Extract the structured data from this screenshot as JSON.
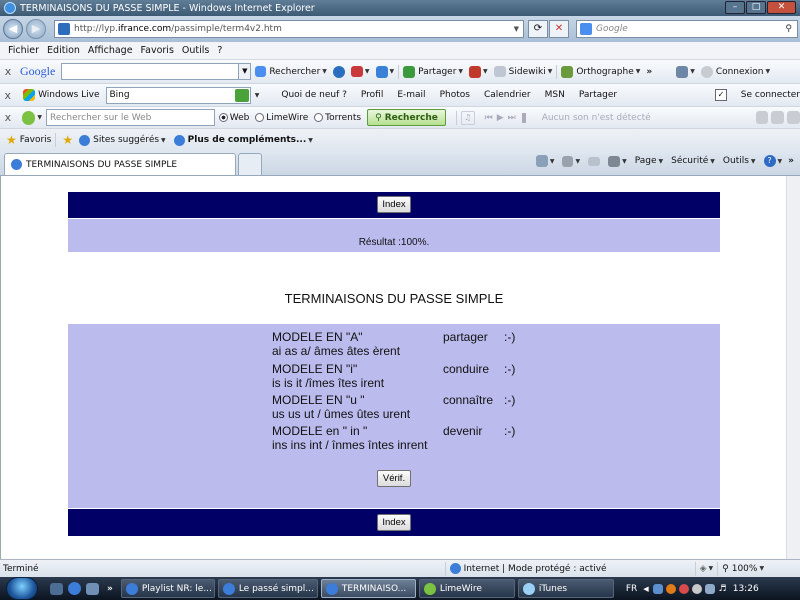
{
  "window": {
    "title": "TERMINAISONS DU PASSE SIMPLE - Windows Internet Explorer"
  },
  "address_bar": {
    "url_prefix": "http://lyp.",
    "url_host": "ifrance.com",
    "url_path": "/passimple/term4v2.htm",
    "search_placeholder": "Google"
  },
  "menu": [
    "Fichier",
    "Edition",
    "Affichage",
    "Favoris",
    "Outils",
    "?"
  ],
  "google_toolbar": {
    "logo": "Google",
    "search_label": "Rechercher",
    "partager": "Partager",
    "sidewiki": "Sidewiki",
    "orthographe": "Orthographe",
    "connexion": "Connexion"
  },
  "live_toolbar": {
    "brand": "Windows Live",
    "search_value": "Bing",
    "links": [
      "Quoi de neuf ?",
      "Profil",
      "E-mail",
      "Photos",
      "Calendrier",
      "MSN",
      "Partager"
    ],
    "sign_in": "Se connecter"
  },
  "limewire_toolbar": {
    "search_placeholder": "Rechercher sur le Web",
    "options": [
      "Web",
      "LimeWire",
      "Torrents"
    ],
    "selected": "Web",
    "search_button": "Recherche",
    "media_status": "Aucun son n'est détecté"
  },
  "favorites_bar": {
    "favoris": "Favoris",
    "suggested": "Sites suggérés",
    "more": "Plus de compléments..."
  },
  "tabs": [
    {
      "label": "TERMINAISONS DU PASSE SIMPLE",
      "active": true
    }
  ],
  "command_bar": {
    "page": "Page",
    "securite": "Sécurité",
    "outils": "Outils"
  },
  "page": {
    "index_label_top": "Index",
    "result": "Résultat :100%.",
    "title": "TERMINAISONS DU PASSE SIMPLE",
    "models": [
      {
        "name": "MODELE EN \"A\"",
        "endings": "ai as a/ âmes âtes èrent",
        "verb": "partager",
        "feedback": ":-)"
      },
      {
        "name": "MODELE EN \"i\"",
        "endings": "is is it /îmes îtes irent",
        "verb": "conduire",
        "feedback": ":-)"
      },
      {
        "name": "MODELE EN \"u \"",
        "endings": "us us ut / ûmes ûtes urent",
        "verb": "connaître",
        "feedback": ":-)"
      },
      {
        "name": "MODELE en \" in \"",
        "endings": "ins ins int / înmes întes inrent",
        "verb": "devenir",
        "feedback": ":-)"
      }
    ],
    "verify_label": "Vérif.",
    "index_label_bottom": "Index"
  },
  "status_bar": {
    "text": "Terminé",
    "zone": "Internet | Mode protégé : activé",
    "zoom": "100%"
  },
  "taskbar": {
    "tasks": [
      {
        "label": "Playlist NR: le...",
        "active": false
      },
      {
        "label": "Le passé simpl...",
        "active": false
      },
      {
        "label": "TERMINAISO...",
        "active": true
      },
      {
        "label": "LimeWire",
        "active": false
      },
      {
        "label": "iTunes",
        "active": false
      }
    ],
    "lang": "FR",
    "clock": "13:26"
  },
  "colors": {
    "navy_band": "#000066",
    "lavender_panel": "#bbbbee"
  }
}
